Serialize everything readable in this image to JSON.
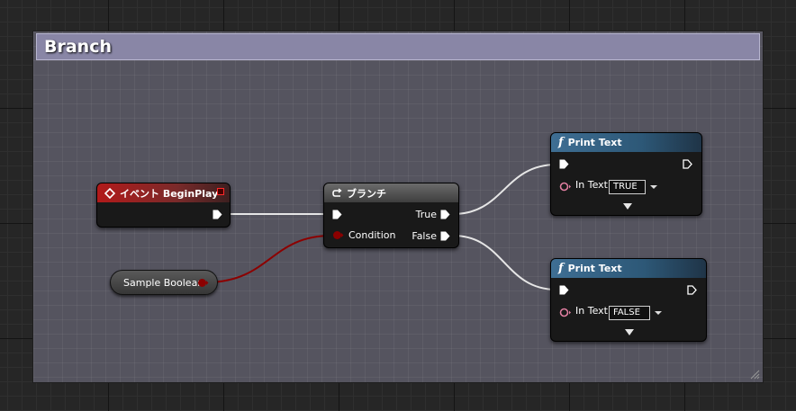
{
  "comment": {
    "title": "Branch"
  },
  "nodes": {
    "event": {
      "title": "イベント BeginPlay"
    },
    "branch": {
      "title": "ブランチ",
      "condition_label": "Condition",
      "true_label": "True",
      "false_label": "False"
    },
    "print_true": {
      "title": "Print Text",
      "in_text_label": "In Text",
      "in_text_value": "TRUE"
    },
    "print_false": {
      "title": "Print Text",
      "in_text_label": "In Text",
      "in_text_value": "FALSE"
    },
    "variable": {
      "label": "Sample Boolean"
    }
  },
  "colors": {
    "event_header": "#b21a1a",
    "function_header": "#3e6e93",
    "boolean_pin": "#8c0000",
    "text_pin": "#e07ea0",
    "comment_header": "#8986a6",
    "comment_body": "#55545f"
  },
  "icons": {
    "event": "event-diamond-icon",
    "branch": "branch-arrow-icon",
    "function": "function-f-icon"
  }
}
